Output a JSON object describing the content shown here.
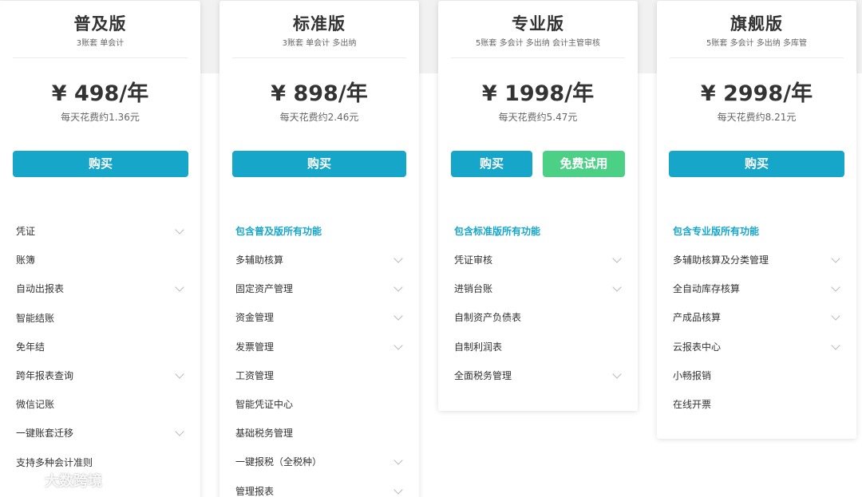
{
  "plans": [
    {
      "name": "普及版",
      "subtitle": "3账套 单会计",
      "price": "¥ 498/年",
      "daily": "每天花费约1.36元",
      "buttons": [
        {
          "label": "购买",
          "kind": "buy"
        }
      ],
      "include_text": "",
      "features": [
        {
          "label": "凭证",
          "expandable": true
        },
        {
          "label": "账簿",
          "expandable": false
        },
        {
          "label": "自动出报表",
          "expandable": true
        },
        {
          "label": "智能结账",
          "expandable": false
        },
        {
          "label": "免年结",
          "expandable": false
        },
        {
          "label": "跨年报表查询",
          "expandable": true
        },
        {
          "label": "微信记账",
          "expandable": false
        },
        {
          "label": "一键账套迁移",
          "expandable": true
        },
        {
          "label": "支持多种会计准则",
          "expandable": false
        }
      ]
    },
    {
      "name": "标准版",
      "subtitle": "3账套 单会计 多出纳",
      "price": "¥ 898/年",
      "daily": "每天花费约2.46元",
      "buttons": [
        {
          "label": "购买",
          "kind": "buy"
        }
      ],
      "include_text": "包含普及版所有功能",
      "features": [
        {
          "label": "多辅助核算",
          "expandable": true
        },
        {
          "label": "固定资产管理",
          "expandable": true
        },
        {
          "label": "资金管理",
          "expandable": true
        },
        {
          "label": "发票管理",
          "expandable": true
        },
        {
          "label": "工资管理",
          "expandable": false
        },
        {
          "label": "智能凭证中心",
          "expandable": false
        },
        {
          "label": "基础税务管理",
          "expandable": false
        },
        {
          "label": "一键报税（全税种）",
          "expandable": true
        },
        {
          "label": "管理报表",
          "expandable": true
        }
      ]
    },
    {
      "name": "专业版",
      "subtitle": "5账套 多会计 多出纳 会计主管审核",
      "price": "¥ 1998/年",
      "daily": "每天花费约5.47元",
      "buttons": [
        {
          "label": "购买",
          "kind": "buy"
        },
        {
          "label": "免费试用",
          "kind": "trial"
        }
      ],
      "include_text": "包含标准版所有功能",
      "features": [
        {
          "label": "凭证审核",
          "expandable": true
        },
        {
          "label": "进销台账",
          "expandable": true
        },
        {
          "label": "自制资产负债表",
          "expandable": false
        },
        {
          "label": "自制利润表",
          "expandable": false
        },
        {
          "label": "全面税务管理",
          "expandable": true
        }
      ]
    },
    {
      "name": "旗舰版",
      "subtitle": "5账套 多会计 多出纳 多库管",
      "price": "¥ 2998/年",
      "daily": "每天花费约8.21元",
      "buttons": [
        {
          "label": "购买",
          "kind": "buy"
        }
      ],
      "include_text": "包含专业版所有功能",
      "features": [
        {
          "label": "多辅助核算及分类管理",
          "expandable": true
        },
        {
          "label": "全自动库存核算",
          "expandable": true
        },
        {
          "label": "产成品核算",
          "expandable": true
        },
        {
          "label": "云报表中心",
          "expandable": true
        },
        {
          "label": "小畅报销",
          "expandable": false
        },
        {
          "label": "在线开票",
          "expandable": false
        }
      ]
    }
  ],
  "watermark": {
    "text": "大数跨境"
  },
  "colors": {
    "accent": "#16a6c9",
    "trial": "#4cd086",
    "band": "#f1f1f1"
  }
}
